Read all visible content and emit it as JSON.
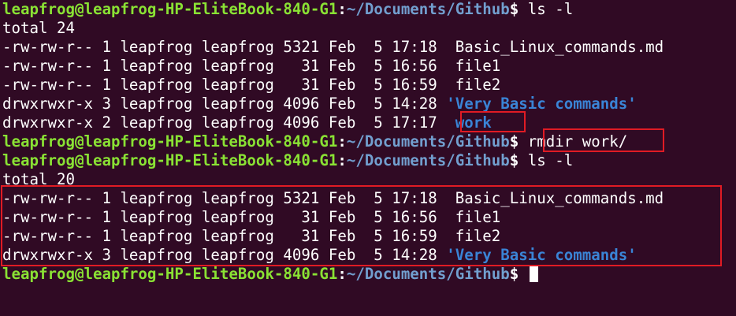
{
  "prompt": {
    "user_host": "leapfrog@leapfrog-HP-EliteBook-840-G1",
    "separator": ":",
    "path": "~/Documents/Github",
    "symbol": "$"
  },
  "lines": [
    {
      "kind": "prompt",
      "cmd": " ls -l"
    },
    {
      "kind": "text",
      "text": "total 24"
    },
    {
      "kind": "entry",
      "meta": "-rw-rw-r-- 1 leapfrog leapfrog 5321 Feb  5 17:18  ",
      "name": "Basic_Linux_commands.md",
      "is_dir": false
    },
    {
      "kind": "entry",
      "meta": "-rw-rw-r-- 1 leapfrog leapfrog   31 Feb  5 16:56  ",
      "name": "file1",
      "is_dir": false
    },
    {
      "kind": "entry",
      "meta": "-rw-rw-r-- 1 leapfrog leapfrog   31 Feb  5 16:59  ",
      "name": "file2",
      "is_dir": false
    },
    {
      "kind": "entry",
      "meta": "drwxrwxr-x 3 leapfrog leapfrog 4096 Feb  5 14:28 ",
      "name": "'Very Basic commands'",
      "is_dir": true
    },
    {
      "kind": "entry",
      "meta": "drwxrwxr-x 2 leapfrog leapfrog 4096 Feb  5 17:17  ",
      "name": "work",
      "is_dir": true
    },
    {
      "kind": "prompt",
      "cmd": " rmdir work/"
    },
    {
      "kind": "prompt",
      "cmd": " ls -l"
    },
    {
      "kind": "text",
      "text": "total 20"
    },
    {
      "kind": "entry",
      "meta": "-rw-rw-r-- 1 leapfrog leapfrog 5321 Feb  5 17:18  ",
      "name": "Basic_Linux_commands.md",
      "is_dir": false
    },
    {
      "kind": "entry",
      "meta": "-rw-rw-r-- 1 leapfrog leapfrog   31 Feb  5 16:56  ",
      "name": "file1",
      "is_dir": false
    },
    {
      "kind": "entry",
      "meta": "-rw-rw-r-- 1 leapfrog leapfrog   31 Feb  5 16:59  ",
      "name": "file2",
      "is_dir": false
    },
    {
      "kind": "entry",
      "meta": "drwxrwxr-x 3 leapfrog leapfrog 4096 Feb  5 14:28 ",
      "name": "'Very Basic commands'",
      "is_dir": true
    },
    {
      "kind": "prompt",
      "cmd": " ",
      "cursor": true
    }
  ],
  "colors": {
    "background": "#300a24",
    "prompt_user": "#8ae234",
    "prompt_path": "#729fcf",
    "directory": "#3a84d6",
    "highlight": "#e01b24"
  }
}
